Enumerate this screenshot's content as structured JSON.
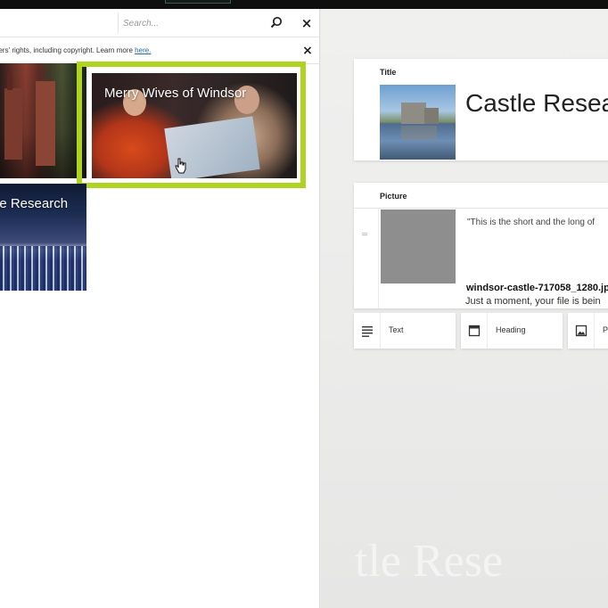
{
  "search": {
    "placeholder": "Search..."
  },
  "notice": {
    "text": "hers' rights, including copyright. Learn more ",
    "link": "here."
  },
  "tiles": [
    {
      "title": ""
    },
    {
      "title": "Merry Wives of Windsor"
    },
    {
      "title": "le Research"
    }
  ],
  "editor": {
    "title_card": {
      "label": "Title",
      "title": "Castle Resea"
    },
    "picture_card": {
      "label": "Picture",
      "quote": "\"This is the short and the long of",
      "filename": "windsor-castle-717058_1280.jp",
      "status": "Just a moment, your file is bein"
    },
    "blocks": [
      {
        "label": "Text"
      },
      {
        "label": "Heading"
      },
      {
        "label": "P"
      }
    ],
    "watermark": "tle Rese"
  },
  "colors": {
    "highlight": "#aed321",
    "link": "#1f6ba8"
  }
}
